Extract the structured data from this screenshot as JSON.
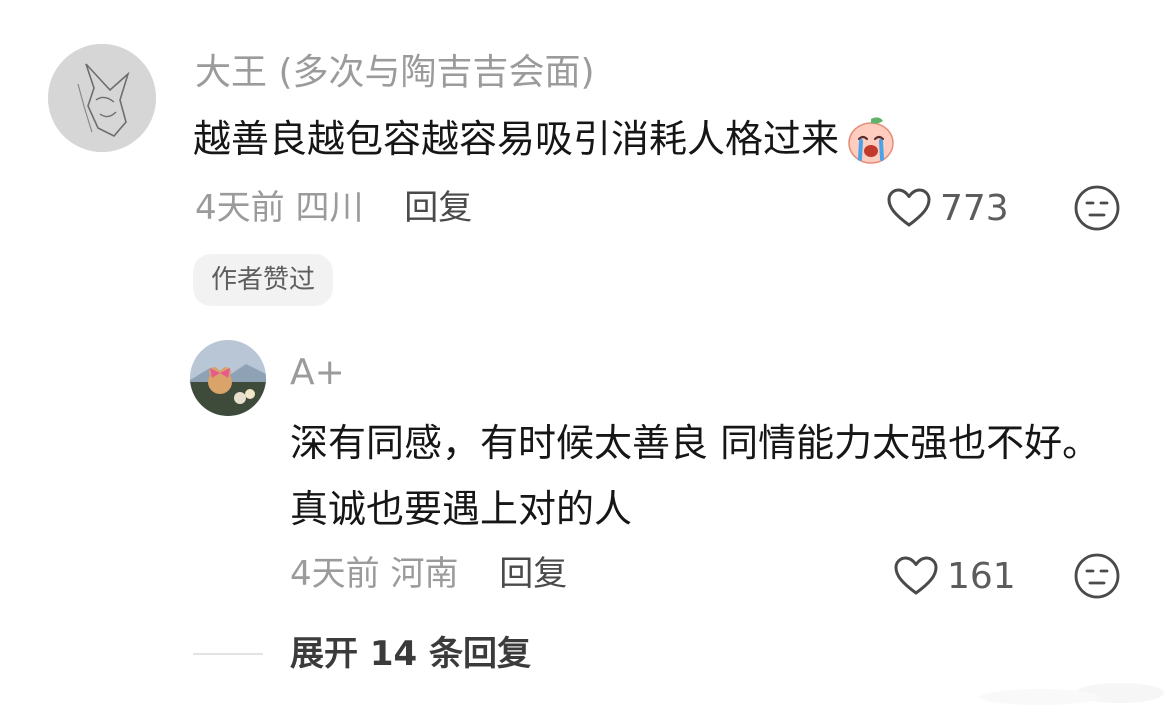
{
  "main_comment": {
    "username": "大王 (多次与陶吉吉会面)",
    "text": "越善良越包容越容易吸引消耗人格过来",
    "emoji": "crying-peach-emoji",
    "time": "4天前",
    "location": "四川",
    "reply_label": "回复",
    "likes": "773",
    "author_liked_badge": "作者赞过"
  },
  "sub_comment": {
    "username": "A+",
    "text": "深有同感，有时候太善良 同情能力太强也不好。真诚也要遇上对的人",
    "time": "4天前",
    "location": "河南",
    "reply_label": "回复",
    "likes": "161"
  },
  "expand_replies_label": "展开 14 条回复",
  "colors": {
    "secondary_text": "#9b9b9b",
    "primary_text": "#161616",
    "badge_bg": "#f2f2f2"
  }
}
